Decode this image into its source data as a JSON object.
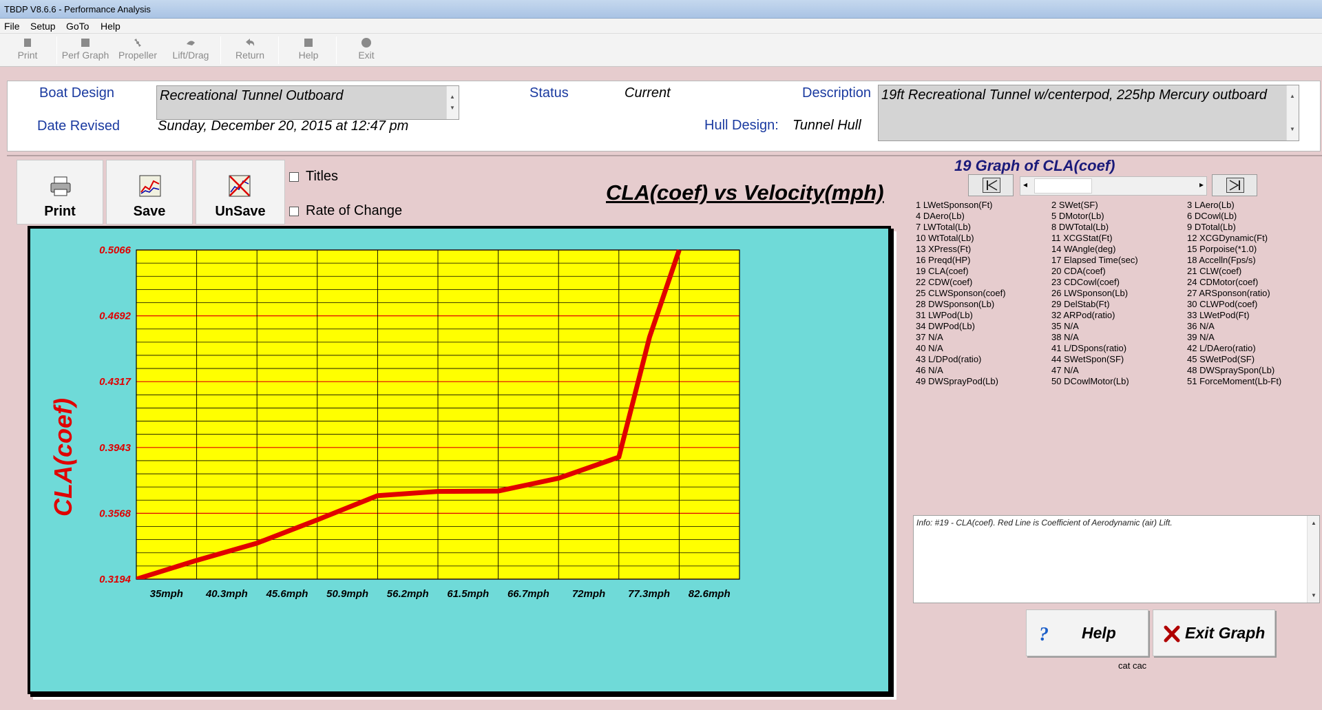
{
  "window": {
    "title": "TBDP V8.6.6 - Performance Analysis"
  },
  "menu": {
    "items": [
      "File",
      "Setup",
      "GoTo",
      "Help"
    ]
  },
  "toolbar": {
    "buttons": [
      {
        "label": "Print",
        "icon": "print-icon"
      },
      {
        "label": "Perf Graph",
        "icon": "perf-graph-icon"
      },
      {
        "label": "Propeller",
        "icon": "propeller-icon"
      },
      {
        "label": "Lift/Drag",
        "icon": "lift-drag-icon"
      },
      {
        "label": "Return",
        "icon": "return-icon"
      },
      {
        "label": "Help",
        "icon": "help-icon"
      },
      {
        "label": "Exit",
        "icon": "exit-icon"
      }
    ]
  },
  "info": {
    "boat_design_label": "Boat Design",
    "boat_design_value": "Recreational Tunnel Outboard",
    "date_revised_label": "Date Revised",
    "date_revised_value": "Sunday, December 20, 2015 at 12:47 pm",
    "status_label": "Status",
    "status_value": "Current",
    "hull_design_label": "Hull Design:",
    "hull_design_value": "Tunnel Hull",
    "description_label": "Description",
    "description_value": "19ft Recreational Tunnel w/centerpod, 225hp Mercury outboard"
  },
  "graph_buttons": {
    "print": "Print",
    "save": "Save",
    "unsave": "UnSave"
  },
  "options": {
    "titles_label": "Titles",
    "titles_checked": false,
    "rate_label": "Rate of Change",
    "rate_checked": false
  },
  "chart_title": "CLA(coef) vs Velocity(mph)",
  "chart_data": {
    "type": "line",
    "title": "CLA(coef) vs Velocity(mph)",
    "ylabel": "CLA(coef)",
    "xlabel": "",
    "categories": [
      "35mph",
      "40.3mph",
      "45.6mph",
      "50.9mph",
      "56.2mph",
      "61.5mph",
      "66.7mph",
      "72mph",
      "77.3mph",
      "82.6mph"
    ],
    "x_ticks": [
      35,
      40.3,
      45.6,
      50.9,
      56.2,
      61.5,
      66.7,
      72,
      77.3,
      82.6
    ],
    "y_ticks": [
      "0.3194",
      "0.3568",
      "0.3943",
      "0.4317",
      "0.4692",
      "0.5066"
    ],
    "ylim": [
      0.3194,
      0.5066
    ],
    "series": [
      {
        "x": [
          35,
          40.3,
          45.6,
          50.9,
          56.2,
          61.5,
          66.7,
          72,
          77.3,
          80.0,
          82.6
        ],
        "y": [
          0.3194,
          0.3301,
          0.3399,
          0.3531,
          0.3669,
          0.3693,
          0.3695,
          0.3768,
          0.3888,
          0.4571,
          0.5066
        ],
        "color": "#e00000"
      }
    ],
    "plot_bg": "#ffff00",
    "frame_bg": "#6fdad8",
    "grid": true,
    "grid_major_color": "#e00000",
    "grid_minor_color": "#000000"
  },
  "right_panel": {
    "graph_title": "19 Graph of CLA(coef)",
    "params": [
      "1 LWetSponson(Ft)",
      "2 SWet(SF)",
      "3 LAero(Lb)",
      "4 DAero(Lb)",
      "5 DMotor(Lb)",
      "6 DCowl(Lb)",
      "7 LWTotal(Lb)",
      "8 DWTotal(Lb)",
      "9 DTotal(Lb)",
      "10 WtTotal(Lb)",
      "11 XCGStat(Ft)",
      "12 XCGDynamic(Ft)",
      "13 XPress(Ft)",
      "14 WAngle(deg)",
      "15 Porpoise(*1.0)",
      "16 Preqd(HP)",
      "17 Elapsed Time(sec)",
      "18 Accelln(Fps/s)",
      "19 CLA(coef)",
      "20 CDA(coef)",
      "21 CLW(coef)",
      "22 CDW(coef)",
      "23 CDCowl(coef)",
      "24 CDMotor(coef)",
      "25 CLWSponson(coef)",
      "26 LWSponson(Lb)",
      "27 ARSponson(ratio)",
      "28 DWSponson(Lb)",
      "29 DelStab(Ft)",
      "30 CLWPod(coef)",
      "31 LWPod(Lb)",
      "32 ARPod(ratio)",
      "33 LWetPod(Ft)",
      "34 DWPod(Lb)",
      "35 N/A",
      "36 N/A",
      "37 N/A",
      "38 N/A",
      "39 N/A",
      "40 N/A",
      "41 L/DSpons(ratio)",
      "42 L/DAero(ratio)",
      "43 L/DPod(ratio)",
      "44 SWetSpon(SF)",
      "45 SWetPod(SF)",
      "46 N/A",
      "47 N/A",
      "48 DWSpraySpon(Lb)",
      "49 DWSprayPod(Lb)",
      "50 DCowlMotor(Lb)",
      "51 ForceMoment(Lb-Ft)"
    ],
    "info_text": "Info: #19 - CLA(coef). Red Line is Coefficient of Aerodynamic (air) Lift.",
    "help_label": "Help",
    "exit_label": "Exit Graph",
    "footnote": "cat cac"
  }
}
